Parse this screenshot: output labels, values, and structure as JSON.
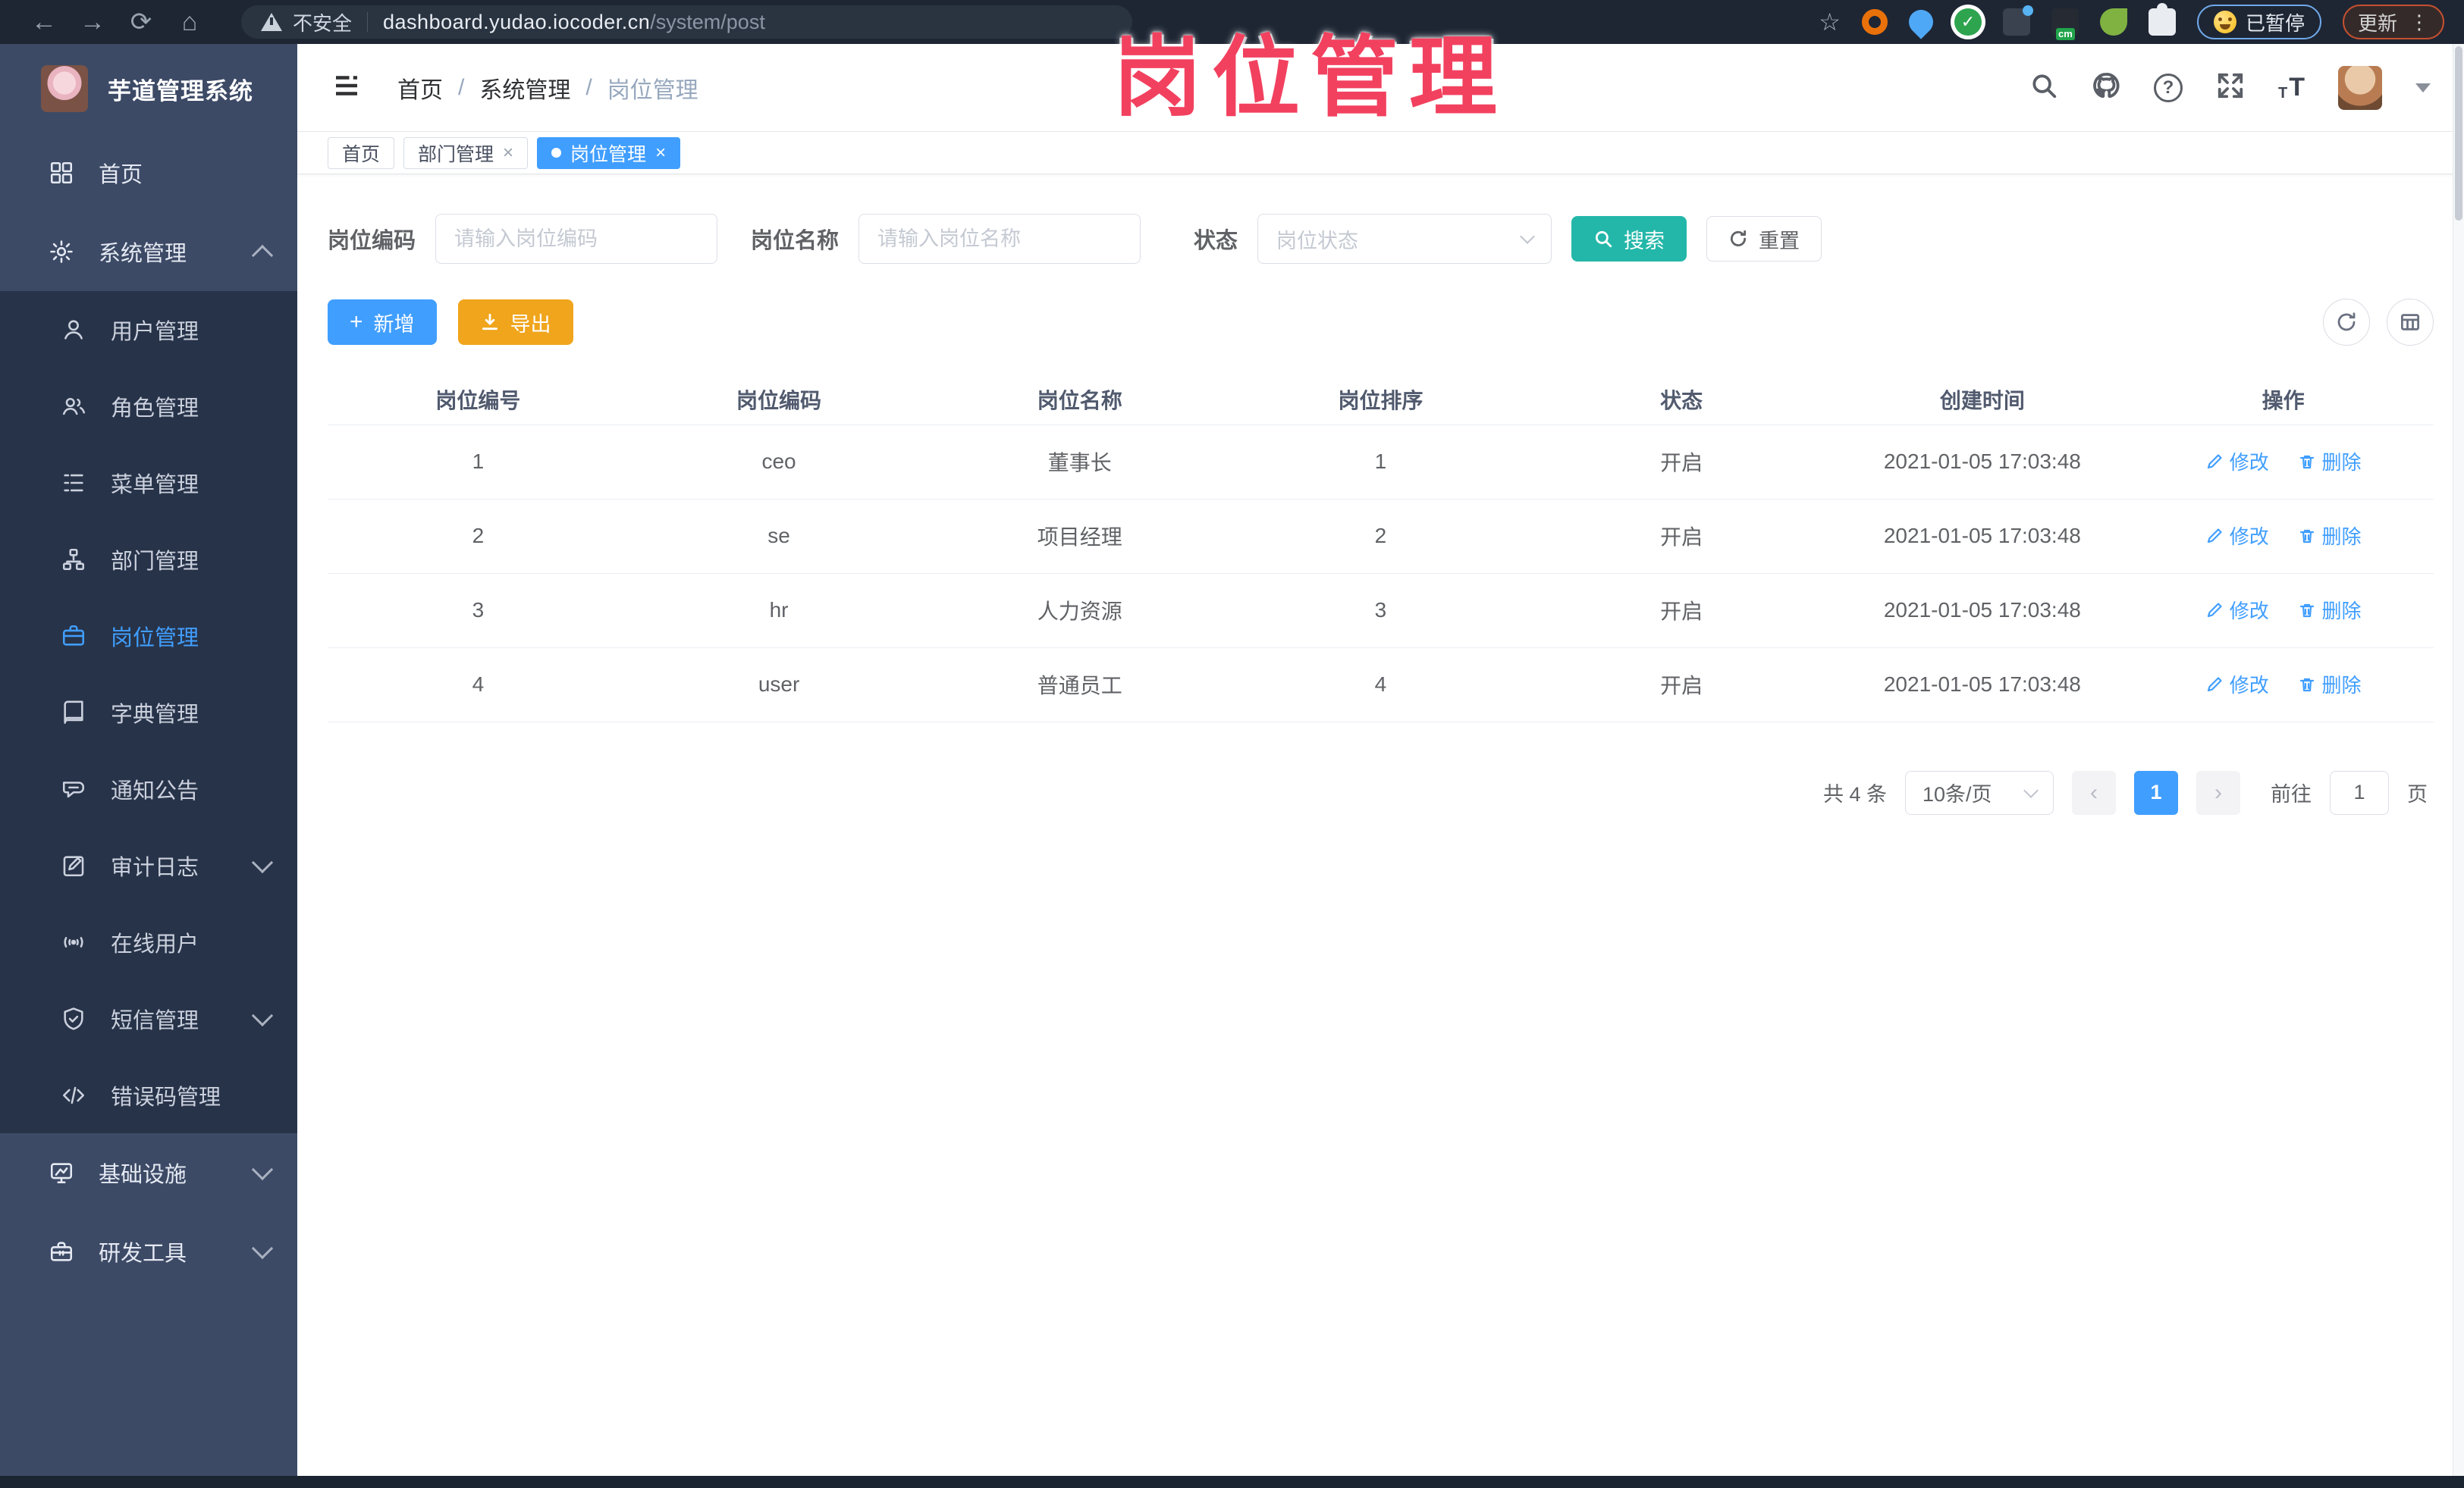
{
  "overlay": {
    "title": "岗位管理"
  },
  "browser": {
    "security_label": "不安全",
    "url_host": "dashboard.yudao.iocoder.cn",
    "url_path": "/system/post",
    "paused_label": "已暂停",
    "update_label": "更新"
  },
  "sidebar": {
    "app_title": "芋道管理系统",
    "items": [
      {
        "label": "首页"
      },
      {
        "label": "系统管理"
      },
      {
        "label": "用户管理"
      },
      {
        "label": "角色管理"
      },
      {
        "label": "菜单管理"
      },
      {
        "label": "部门管理"
      },
      {
        "label": "岗位管理"
      },
      {
        "label": "字典管理"
      },
      {
        "label": "通知公告"
      },
      {
        "label": "审计日志"
      },
      {
        "label": "在线用户"
      },
      {
        "label": "短信管理"
      },
      {
        "label": "错误码管理"
      },
      {
        "label": "基础设施"
      },
      {
        "label": "研发工具"
      }
    ]
  },
  "header": {
    "breadcrumb": [
      "首页",
      "系统管理",
      "岗位管理"
    ],
    "separator": "/"
  },
  "tabs": [
    {
      "label": "首页"
    },
    {
      "label": "部门管理"
    },
    {
      "label": "岗位管理"
    }
  ],
  "filters": {
    "post_code_label": "岗位编码",
    "post_code_placeholder": "请输入岗位编码",
    "post_name_label": "岗位名称",
    "post_name_placeholder": "请输入岗位名称",
    "status_label": "状态",
    "status_placeholder": "岗位状态",
    "search_label": "搜索",
    "reset_label": "重置"
  },
  "toolbar": {
    "add_label": "新增",
    "export_label": "导出"
  },
  "table": {
    "columns": [
      "岗位编号",
      "岗位编码",
      "岗位名称",
      "岗位排序",
      "状态",
      "创建时间",
      "操作"
    ],
    "edit_label": "修改",
    "delete_label": "删除",
    "rows": [
      {
        "id": "1",
        "code": "ceo",
        "name": "董事长",
        "sort": "1",
        "status": "开启",
        "created": "2021-01-05 17:03:48"
      },
      {
        "id": "2",
        "code": "se",
        "name": "项目经理",
        "sort": "2",
        "status": "开启",
        "created": "2021-01-05 17:03:48"
      },
      {
        "id": "3",
        "code": "hr",
        "name": "人力资源",
        "sort": "3",
        "status": "开启",
        "created": "2021-01-05 17:03:48"
      },
      {
        "id": "4",
        "code": "user",
        "name": "普通员工",
        "sort": "4",
        "status": "开启",
        "created": "2021-01-05 17:03:48"
      }
    ]
  },
  "pagination": {
    "total_text": "共 4 条",
    "page_size": "10条/页",
    "current_page": "1",
    "goto_label": "前往",
    "goto_value": "1",
    "page_suffix": "页"
  },
  "colors": {
    "accent": "#409EFF",
    "search_button": "#23B7A9",
    "export_button": "#F0A51C",
    "annotation": "#F2415F"
  }
}
